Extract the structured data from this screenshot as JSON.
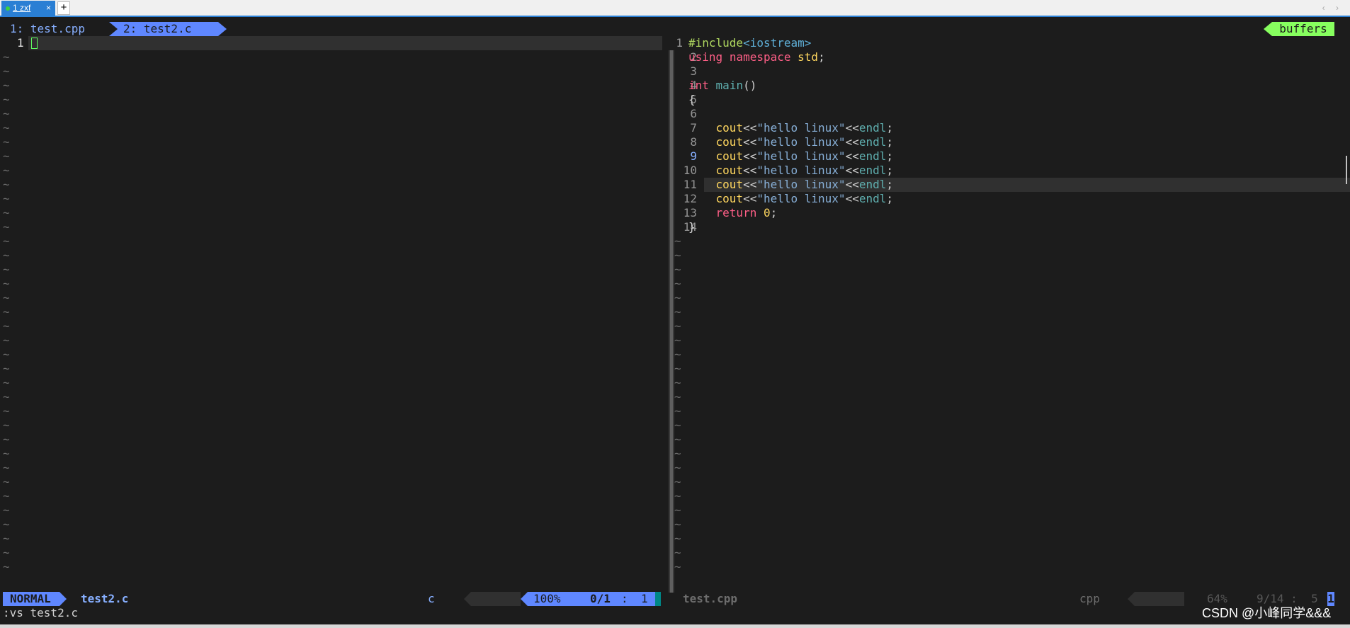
{
  "terminal": {
    "tab_label": "1 zxf",
    "close_glyph": "×",
    "add_glyph": "+",
    "nav_glyph": "‹ ›"
  },
  "tabline": {
    "tab1": "1: test.cpp",
    "tab2": "2: test2.c",
    "buffers": "buffers"
  },
  "left_window": {
    "line_number": "1",
    "tilde": "~"
  },
  "right_window": {
    "line_numbers": [
      "1",
      "2",
      "3",
      "4",
      "5",
      "6",
      "7",
      "8",
      "9",
      "10",
      "11",
      "12",
      "13",
      "14"
    ],
    "current_line": "9",
    "code": {
      "l1_a": "#include",
      "l1_b": "<iostream>",
      "l2_a": "using",
      "l2_b": "namespace",
      "l2_c": "std",
      "l2_d": ";",
      "l4_a": "int",
      "l4_b": "main",
      "l4_c": "()",
      "l5": "{",
      "cout": "cout",
      "op": "<<",
      "str": "\"hello linux\"",
      "endl": "endl",
      "semi": ";",
      "ret": "return",
      "zero": "0",
      "l14": "}"
    }
  },
  "status_left": {
    "mode": "NORMAL",
    "file": "test2.c",
    "filetype": "c",
    "percent": "100%",
    "position": "0/1",
    "colon": ":",
    "column": "1"
  },
  "status_right": {
    "file": "test.cpp",
    "filetype": "cpp",
    "percent": "64%",
    "position": "9/14 :  5",
    "cursor_col": "1"
  },
  "command_line": ":vs test2.c",
  "watermark": "CSDN @小峰同学&&&"
}
